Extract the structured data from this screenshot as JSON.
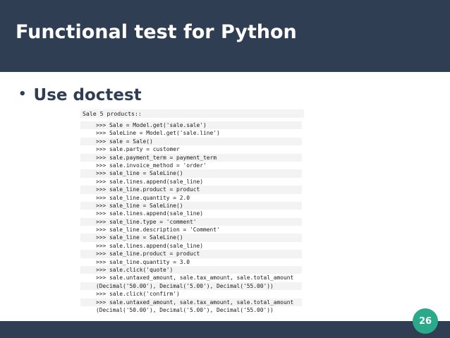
{
  "slide": {
    "title": "Functional test for Python",
    "bullet": "Use doctest",
    "code_title": "Sale 5 products::",
    "page_number": "26"
  },
  "code_lines": [
    ">>> Sale = Model.get('sale.sale')",
    ">>> SaleLine = Model.get('sale.line')",
    ">>> sale = Sale()",
    ">>> sale.party = customer",
    ">>> sale.payment_term = payment_term",
    ">>> sale.invoice_method = 'order'",
    ">>> sale_line = SaleLine()",
    ">>> sale.lines.append(sale_line)",
    ">>> sale_line.product = product",
    ">>> sale_line.quantity = 2.0",
    ">>> sale_line = SaleLine()",
    ">>> sale.lines.append(sale_line)",
    ">>> sale_line.type = 'comment'",
    ">>> sale_line.description = 'Comment'",
    ">>> sale_line = SaleLine()",
    ">>> sale.lines.append(sale_line)",
    ">>> sale_line.product = product",
    ">>> sale_line.quantity = 3.0",
    ">>> sale.click('quote')",
    ">>> sale.untaxed_amount, sale.tax_amount, sale.total_amount",
    "(Decimal('50.00'), Decimal('5.00'), Decimal('55.00'))",
    ">>> sale.click('confirm')",
    ">>> sale.untaxed_amount, sale.tax_amount, sale.total_amount",
    "(Decimal('50.00'), Decimal('5.00'), Decimal('55.00'))"
  ],
  "colors": {
    "header_bg": "#2f3e52",
    "badge_bg": "#2aaa8a",
    "code_row_bg": "#f3f3f3"
  }
}
